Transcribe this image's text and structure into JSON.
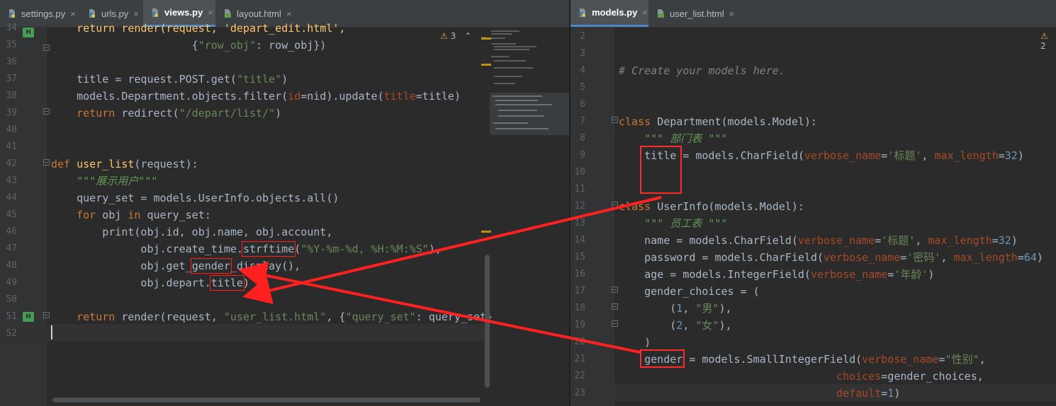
{
  "left": {
    "tabs": [
      {
        "label": "settings.py",
        "icon": "python-file-icon",
        "active": false
      },
      {
        "label": "urls.py",
        "icon": "python-file-icon",
        "active": false
      },
      {
        "label": "views.py",
        "icon": "python-file-icon",
        "active": true
      },
      {
        "label": "layout.html",
        "icon": "html-file-icon",
        "active": false
      }
    ],
    "warnings": {
      "icon": "warning-icon",
      "count": "3"
    },
    "lines": [
      {
        "n": "34",
        "c": [
          [
            "fn",
            "    return render(request, 'depart_edit.html',"
          ]
        ]
      },
      {
        "n": "35",
        "c": [
          [
            "",
            "                      {"
          ],
          [
            "str",
            "\"row_obj\""
          ],
          [
            "",
            ": row_obj})"
          ]
        ]
      },
      {
        "n": "36",
        "c": []
      },
      {
        "n": "37",
        "c": [
          [
            "",
            "    title = request.POST.get("
          ],
          [
            "str",
            "\"title\""
          ],
          [
            "",
            ")"
          ]
        ]
      },
      {
        "n": "38",
        "c": [
          [
            "",
            "    models.Department.objects.filter("
          ],
          [
            "prm",
            "id"
          ],
          [
            "",
            "=nid).update("
          ],
          [
            "prm",
            "title"
          ],
          [
            "",
            "=title)"
          ]
        ]
      },
      {
        "n": "39",
        "c": [
          [
            "kw",
            "    return "
          ],
          [
            "",
            "redirect("
          ],
          [
            "str",
            "\"/depart/list/\""
          ],
          [
            "",
            ")"
          ]
        ]
      },
      {
        "n": "40",
        "c": []
      },
      {
        "n": "41",
        "c": []
      },
      {
        "n": "42",
        "c": [
          [
            "kw",
            "def "
          ],
          [
            "fn",
            "user_list"
          ],
          [
            "",
            "(request):"
          ]
        ]
      },
      {
        "n": "43",
        "c": [
          [
            "doc",
            "    \"\"\"展示用户\"\"\""
          ]
        ]
      },
      {
        "n": "44",
        "c": [
          [
            "",
            "    query_set = models.UserInfo.objects.all()"
          ]
        ]
      },
      {
        "n": "45",
        "c": [
          [
            "kw",
            "    for "
          ],
          [
            "",
            "obj "
          ],
          [
            "kw",
            "in "
          ],
          [
            "",
            "query_set:"
          ]
        ]
      },
      {
        "n": "46",
        "c": [
          [
            "",
            "        print(obj.id, obj.name, obj.account,"
          ]
        ]
      },
      {
        "n": "47",
        "c": [
          [
            "",
            "              obj.create_time."
          ],
          [
            "hl",
            "strftime"
          ],
          [
            "",
            "("
          ],
          [
            "str",
            "\"%Y-%m-%d, %H:%M:%S\""
          ],
          [
            "",
            "),"
          ]
        ]
      },
      {
        "n": "48",
        "c": [
          [
            "",
            "              obj.get_"
          ],
          [
            "hl",
            "gender"
          ],
          [
            "",
            "_display(),"
          ]
        ]
      },
      {
        "n": "49",
        "c": [
          [
            "",
            "              obj.depart."
          ],
          [
            "hl",
            "title"
          ],
          [
            "",
            ")"
          ]
        ]
      },
      {
        "n": "50",
        "c": []
      },
      {
        "n": "51",
        "c": [
          [
            "kw",
            "    return "
          ],
          [
            "",
            "render(request, "
          ],
          [
            "str",
            "\"user_list.html\""
          ],
          [
            "",
            ", {"
          ],
          [
            "str",
            "\"query_set\""
          ],
          [
            "",
            ": query_set}"
          ]
        ]
      },
      {
        "n": "52",
        "c": []
      }
    ]
  },
  "right": {
    "tabs": [
      {
        "label": "models.py",
        "icon": "python-file-icon",
        "active": true
      },
      {
        "label": "user_list.html",
        "icon": "html-file-icon",
        "active": false
      }
    ],
    "warnings": {
      "icon": "warning-icon",
      "count": "2"
    },
    "lines": [
      {
        "n": "2",
        "c": []
      },
      {
        "n": "3",
        "c": []
      },
      {
        "n": "4",
        "c": [
          [
            "cm",
            "# Create your models here."
          ]
        ]
      },
      {
        "n": "5",
        "c": []
      },
      {
        "n": "6",
        "c": []
      },
      {
        "n": "7",
        "c": [
          [
            "kw",
            "class "
          ],
          [
            "",
            "Department(models.Model):"
          ]
        ]
      },
      {
        "n": "8",
        "c": [
          [
            "doc",
            "    \"\"\" 部门表 \"\"\""
          ]
        ]
      },
      {
        "n": "9",
        "c": [
          [
            "",
            "    title = models.CharField("
          ],
          [
            "prm",
            "verbose_name"
          ],
          [
            "",
            "="
          ],
          [
            "str",
            "'标题'"
          ],
          [
            "",
            ", "
          ],
          [
            "prm",
            "max_length"
          ],
          [
            "",
            "="
          ],
          [
            "num",
            "32"
          ],
          [
            "",
            ")"
          ]
        ]
      },
      {
        "n": "10",
        "c": []
      },
      {
        "n": "11",
        "c": []
      },
      {
        "n": "12",
        "c": [
          [
            "kw",
            "class "
          ],
          [
            "",
            "UserInfo(models.Model):"
          ]
        ]
      },
      {
        "n": "13",
        "c": [
          [
            "doc",
            "    \"\"\" 员工表 \"\"\""
          ]
        ]
      },
      {
        "n": "14",
        "c": [
          [
            "",
            "    name = models.CharField("
          ],
          [
            "prm",
            "verbose_name"
          ],
          [
            "",
            "="
          ],
          [
            "str",
            "'标题'"
          ],
          [
            "",
            ", "
          ],
          [
            "prm",
            "max_length"
          ],
          [
            "",
            "="
          ],
          [
            "num",
            "32"
          ],
          [
            "",
            ")"
          ]
        ]
      },
      {
        "n": "15",
        "c": [
          [
            "",
            "    password = models.CharField("
          ],
          [
            "prm",
            "verbose_name"
          ],
          [
            "",
            "="
          ],
          [
            "str",
            "'密码'"
          ],
          [
            "",
            ", "
          ],
          [
            "prm",
            "max_length"
          ],
          [
            "",
            "="
          ],
          [
            "num",
            "64"
          ],
          [
            "",
            ")"
          ]
        ]
      },
      {
        "n": "16",
        "c": [
          [
            "",
            "    age = models.IntegerField("
          ],
          [
            "prm",
            "verbose_name"
          ],
          [
            "",
            "="
          ],
          [
            "str",
            "'年龄'"
          ],
          [
            "",
            ")"
          ]
        ]
      },
      {
        "n": "17",
        "c": [
          [
            "",
            "    gender_choices = ("
          ]
        ]
      },
      {
        "n": "18",
        "c": [
          [
            "",
            "        ("
          ],
          [
            "num",
            "1"
          ],
          [
            "",
            ", "
          ],
          [
            "str",
            "\"男\""
          ],
          [
            "",
            "),"
          ]
        ]
      },
      {
        "n": "19",
        "c": [
          [
            "",
            "        ("
          ],
          [
            "num",
            "2"
          ],
          [
            "",
            ", "
          ],
          [
            "str",
            "\"女\""
          ],
          [
            "",
            "),"
          ]
        ]
      },
      {
        "n": "20",
        "c": [
          [
            "",
            "    )"
          ]
        ]
      },
      {
        "n": "21",
        "c": [
          [
            "",
            "    gender = models.SmallIntegerField("
          ],
          [
            "prm",
            "verbose_name"
          ],
          [
            "",
            "="
          ],
          [
            "str",
            "\"性别\""
          ],
          [
            "",
            ","
          ]
        ]
      },
      {
        "n": "22",
        "c": [
          [
            "",
            "                                  "
          ],
          [
            "prm",
            "choices"
          ],
          [
            "",
            "=gender_choices,"
          ]
        ]
      },
      {
        "n": "23",
        "c": [
          [
            "",
            "                                  "
          ],
          [
            "prm",
            "default"
          ],
          [
            "",
            "="
          ],
          [
            "num",
            "1"
          ],
          [
            "",
            ")"
          ]
        ]
      }
    ]
  },
  "colors": {
    "editor_bg": "#2b2b2b",
    "tab_bar": "#3c3f41",
    "active_tab": "#4e5254",
    "accent": "#4a88c7",
    "keyword": "#cc7832",
    "function": "#ffc66d",
    "string": "#6a8759",
    "number": "#6897bb",
    "param": "#aa4926",
    "annotation": "#ff2a2a"
  }
}
